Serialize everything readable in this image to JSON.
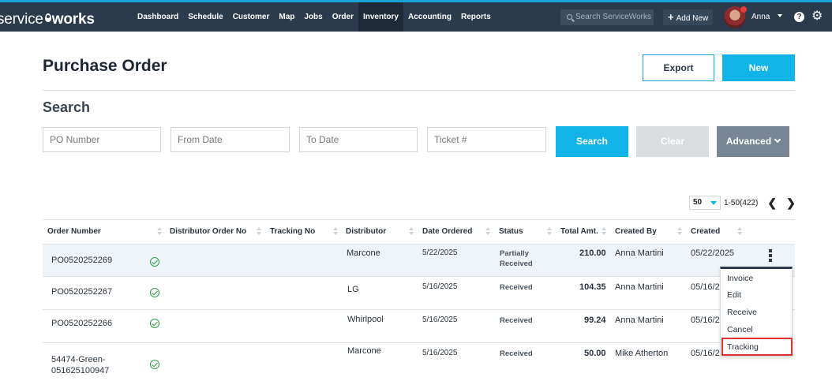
{
  "header": {
    "logo_left": "service",
    "logo_right": "works",
    "nav": [
      "Dashboard",
      "Schedule",
      "Customer",
      "Map",
      "Jobs",
      "Order",
      "Inventory",
      "Accounting",
      "Reports"
    ],
    "active_nav": "Inventory",
    "search_placeholder": "Search ServiceWorks",
    "add_new": "Add New",
    "user": "Anna",
    "help": "?",
    "icons": {
      "search": "search-icon",
      "add": "plus-icon",
      "help": "help-icon",
      "settings": "gear-icon"
    }
  },
  "page": {
    "title": "Purchase Order",
    "export_label": "Export",
    "new_label": "New",
    "search_title": "Search"
  },
  "search": {
    "po_number": "PO Number",
    "from_date": "From Date",
    "to_date": "To Date",
    "ticket": "Ticket #",
    "search_label": "Search",
    "clear_label": "Clear",
    "advanced_label": "Advanced"
  },
  "pager": {
    "page_size": "50",
    "range": "1-50(422)"
  },
  "table": {
    "headers": [
      "Order Number",
      "Distributor Order No",
      "Tracking No",
      "Distributor",
      "Date Ordered",
      "Status",
      "Total Amt.",
      "Created By",
      "Created"
    ],
    "rows": [
      {
        "order": "PO0520252269",
        "distributor": "Marcone",
        "date": "5/22/2025",
        "status_line1": "Partially",
        "status_line2": "Received",
        "total": "210.00",
        "created_by": "Anna Martini",
        "created": "05/22/2025"
      },
      {
        "order": "PO0520252267",
        "distributor": "LG",
        "date": "5/16/2025",
        "status_line1": "Received",
        "status_line2": "",
        "total": "104.35",
        "created_by": "Anna Martini",
        "created": "05/16/20"
      },
      {
        "order": "PO0520252266",
        "distributor": "Whirlpool",
        "date": "5/16/2025",
        "status_line1": "Received",
        "status_line2": "",
        "total": "99.24",
        "created_by": "Anna Martini",
        "created": "05/16/20"
      },
      {
        "order_line1": "54474-Green-",
        "order_line2": "051625100947",
        "distributor": "Marcone",
        "date": "5/16/2025",
        "status_line1": "Received",
        "status_line2": "",
        "total": "50.00",
        "created_by": "Mike Atherton",
        "created": "05/16/20"
      }
    ]
  },
  "menu": {
    "items": [
      "Invoice",
      "Edit",
      "Receive",
      "Cancel",
      "Tracking"
    ],
    "highlighted": "Tracking",
    "highlight_color": "#e0312e"
  },
  "colors": {
    "nav_bg": "#2b3a4c",
    "accent": "#12b3e6",
    "ok_green": "#2f9e44"
  }
}
